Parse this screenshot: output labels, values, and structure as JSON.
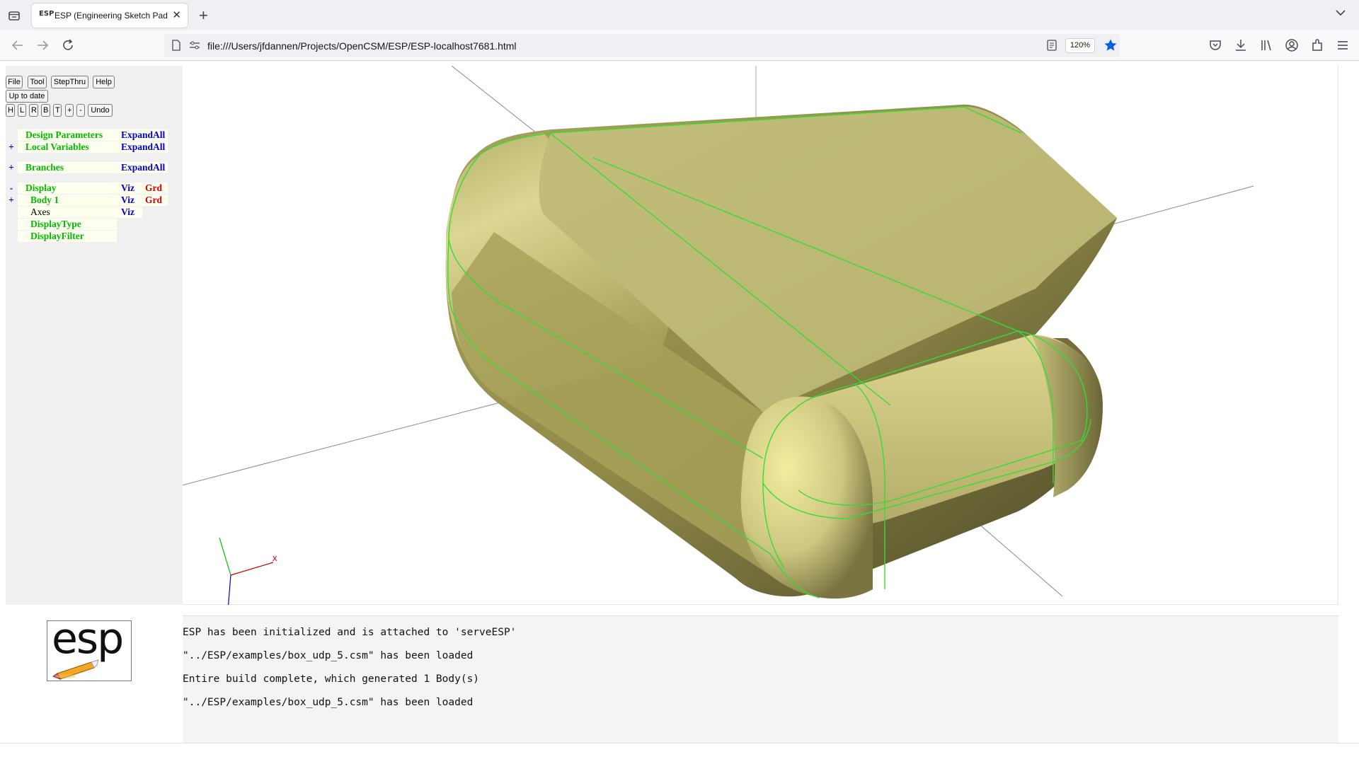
{
  "browser": {
    "tab_title": "ESP (Engineering Sketch Pad, V",
    "tab_favicon": "ESP",
    "url": "file:///Users/jfdannen/Projects/OpenCSM/ESP/ESP-localhost7681.html",
    "zoom": "120%",
    "accent_color": "#0061e0"
  },
  "toolbar": {
    "file": "File",
    "tool": "Tool",
    "stepthru": "StepThru",
    "help": "Help",
    "status": "Up to date",
    "view_h": "H",
    "view_l": "L",
    "view_r": "R",
    "view_b": "B",
    "view_t": "T",
    "zoom_in": "+",
    "zoom_out": "-",
    "undo": "Undo"
  },
  "tree": {
    "design_parameters": {
      "toggle": "",
      "label": "Design Parameters",
      "action": "ExpandAll"
    },
    "local_variables": {
      "toggle": "+",
      "label": "Local Variables",
      "action": "ExpandAll"
    },
    "branches": {
      "toggle": "+",
      "label": "Branches",
      "action": "ExpandAll"
    },
    "display": {
      "toggle": "-",
      "label": "Display",
      "viz": "Viz",
      "grd": "Grd"
    },
    "body1": {
      "toggle": "+",
      "label": "Body 1",
      "viz": "Viz",
      "grd": "Grd"
    },
    "axes": {
      "label": "Axes",
      "viz": "Viz"
    },
    "display_type": {
      "label": "DisplayType"
    },
    "display_filter": {
      "label": "DisplayFilter"
    }
  },
  "logo": {
    "text": "esp"
  },
  "messages": [
    "ESP has been initialized and is attached to 'serveESP'",
    "\"../ESP/examples/box_udp_5.csm\" has been loaded",
    "Entire build complete, which generated 1 Body(s)",
    "\"../ESP/examples/box_udp_5.csm\" has been loaded"
  ],
  "colors": {
    "tree_green": "#00bb00",
    "tree_blue": "#0000cc",
    "tree_red": "#cc0000",
    "body_fill": "#c8c47e",
    "edge_green": "#33dd33"
  },
  "triad": {
    "x_label": "x"
  }
}
